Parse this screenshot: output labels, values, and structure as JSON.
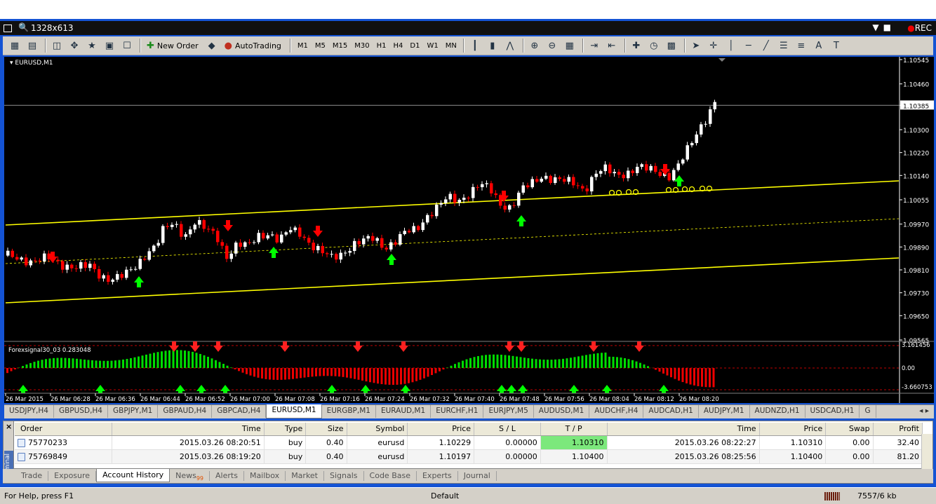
{
  "recorder": {
    "resolution": "1328x613",
    "rec_label": "REC"
  },
  "toolbar": {
    "new_order": "New Order",
    "auto_trading": "AutoTrading",
    "timeframes": [
      "M1",
      "M5",
      "M15",
      "M30",
      "H1",
      "H4",
      "D1",
      "W1",
      "MN"
    ]
  },
  "chart_title": "EURUSD,M1",
  "indicator_label": "Forexsignal30_03 0.283048",
  "current_price": "1.10385",
  "price_ticks": [
    "1.10545",
    "1.10460",
    "1.10385",
    "1.10300",
    "1.10220",
    "1.10140",
    "1.10055",
    "1.09970",
    "1.09890",
    "1.09810",
    "1.09730",
    "1.09650",
    "1.09565"
  ],
  "indicator_ticks": [
    "3.161456",
    "0.00",
    "-3.660753"
  ],
  "time_ticks": [
    "26 Mar 2015",
    "26 Mar 06:28",
    "26 Mar 06:36",
    "26 Mar 06:44",
    "26 Mar 06:52",
    "26 Mar 07:00",
    "26 Mar 07:08",
    "26 Mar 07:16",
    "26 Mar 07:24",
    "26 Mar 07:32",
    "26 Mar 07:40",
    "26 Mar 07:48",
    "26 Mar 07:56",
    "26 Mar 08:04",
    "26 Mar 08:12",
    "26 Mar 08:20"
  ],
  "symbol_tabs": [
    "USDJPY,H4",
    "GBPUSD,H4",
    "GBPJPY,M1",
    "GBPAUD,H4",
    "GBPCAD,H4",
    "EURUSD,M1",
    "EURGBP,M1",
    "EURAUD,M1",
    "EURCHF,H1",
    "EURJPY,M5",
    "AUDUSD,M1",
    "AUDCHF,H4",
    "AUDCAD,H1",
    "AUDJPY,M1",
    "AUDNZD,H1",
    "USDCAD,H1",
    "G"
  ],
  "active_symbol_tab": "EURUSD,M1",
  "history": {
    "columns": [
      "Order",
      "Time",
      "Type",
      "Size",
      "Symbol",
      "Price",
      "S / L",
      "T / P",
      "Time",
      "Price",
      "Swap",
      "Profit"
    ],
    "rows": [
      {
        "order": "75770233",
        "open_time": "2015.03.26 08:20:51",
        "type": "buy",
        "size": "0.40",
        "symbol": "eurusd",
        "price": "1.10229",
        "sl": "0.00000",
        "tp": "1.10310",
        "close_time": "2015.03.26 08:22:27",
        "close_price": "1.10310",
        "swap": "0.00",
        "profit": "32.40"
      },
      {
        "order": "75769849",
        "open_time": "2015.03.26 08:19:20",
        "type": "buy",
        "size": "0.40",
        "symbol": "eurusd",
        "price": "1.10197",
        "sl": "0.00000",
        "tp": "1.10400",
        "close_time": "2015.03.26 08:25:56",
        "close_price": "1.10400",
        "swap": "0.00",
        "profit": "81.20"
      }
    ]
  },
  "terminal_label": "Terminal",
  "terminal_tabs": [
    {
      "label": "Trade"
    },
    {
      "label": "Exposure"
    },
    {
      "label": "Account History",
      "active": true
    },
    {
      "label": "News",
      "badge": "99"
    },
    {
      "label": "Alerts"
    },
    {
      "label": "Mailbox"
    },
    {
      "label": "Market"
    },
    {
      "label": "Signals"
    },
    {
      "label": "Code Base"
    },
    {
      "label": "Experts"
    },
    {
      "label": "Journal"
    }
  ],
  "status": {
    "help": "For Help, press F1",
    "profile": "Default",
    "traffic": "7557/6 kb"
  },
  "colors": {
    "bull": "#ffffff",
    "bear": "#ff0000",
    "channel": "#ffff00",
    "up_arrow": "#00ff00",
    "down_arrow": "#ff0000",
    "tp_fill": "#7ce87c"
  }
}
